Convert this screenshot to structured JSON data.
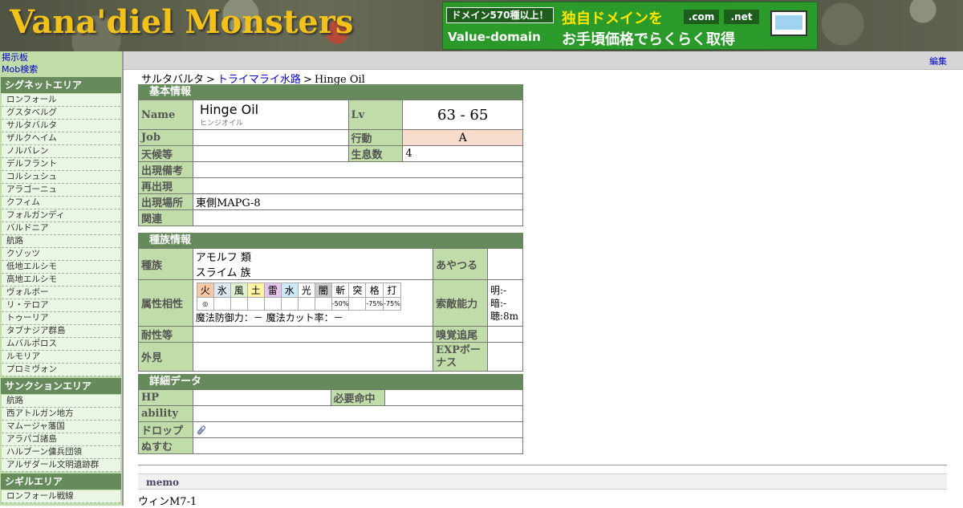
{
  "site": {
    "title": "Vana'diel Monsters"
  },
  "banner": {
    "tag": "ドメイン570種以上！",
    "logo": "Value-domain",
    "line1": "独自ドメインを",
    "line2": "お手頃価格でらくらく取得",
    "tld1": ".com",
    "tld2": ".net"
  },
  "sidebar": {
    "links": [
      "掲示板",
      "Mob検索"
    ],
    "areas": [
      {
        "title": "シグネットエリア",
        "items": [
          "ロンフォール",
          "グスタベルグ",
          "サルタバルタ",
          "ザルクヘイム",
          "ノルバレン",
          "デルフラント",
          "コルシュシュ",
          "アラゴーニュ",
          "クフィム",
          "フォルガンディ",
          "バルドニア",
          "航路",
          "クゾッツ",
          "低地エルシモ",
          "高地エルシモ",
          "ヴォルボー",
          "リ・テロア",
          "トゥーリア",
          "タブナジア群島",
          "ムバルポロス",
          "ルモリア",
          "プロミヴォン"
        ]
      },
      {
        "title": "サンクションエリア",
        "items": [
          "航路",
          "西アトルガン地方",
          "マムージャ藩国",
          "アラパゴ諸島",
          "ハルブーン傭兵団領",
          "アルザダール文明遺跡群"
        ]
      },
      {
        "title": "シギルエリア",
        "items": [
          "ロンフォール戦線"
        ]
      }
    ]
  },
  "topbar": {
    "edit": "編集"
  },
  "breadcrumb": {
    "area": "サルタバルタ",
    "zone": "トライマライ水路",
    "mob": "Hinge Oil",
    "sep": ">"
  },
  "basic": {
    "header": "基本情報",
    "name_label": "Name",
    "name": "Hinge Oil",
    "kana": "ヒンジオイル",
    "lv_label": "Lv",
    "lv": "63 - 65",
    "job_label": "Job",
    "job": "",
    "action_label": "行動",
    "action": "A",
    "weather_label": "天候等",
    "weather": "",
    "count_label": "生息数",
    "count": "4",
    "spawn_note_label": "出現備考",
    "spawn_note": "",
    "respawn_label": "再出現",
    "respawn": "",
    "location_label": "出現場所",
    "location": "東側MAPG-8",
    "related_label": "関連",
    "related": ""
  },
  "race": {
    "header": "種族情報",
    "family_label": "種族",
    "family1": "アモルフ 類",
    "family2": "スライム 族",
    "charm_label": "あやつる",
    "charm": "",
    "affinity_label": "属性相性",
    "elements": [
      "火",
      "氷",
      "風",
      "土",
      "雷",
      "水",
      "光",
      "闇",
      "斬",
      "突",
      "格",
      "打"
    ],
    "element_colors": [
      "#f6c8a8",
      "#dde9f4",
      "#dff2d0",
      "#fff3a0",
      "#e6c6ee",
      "#cce9f6",
      "#ffffff",
      "#cccccc",
      "#ffffff",
      "#ffffff",
      "#ffffff",
      "#ffffff"
    ],
    "element_values": [
      "◎",
      "",
      "",
      "",
      "",
      "",
      "",
      "",
      "-50%",
      "",
      "-75%",
      "-75%"
    ],
    "magic_line": "魔法防御力：－ 魔法カット率：－",
    "detect_label": "索敵能力",
    "detect_light": "明:-",
    "detect_dark": "暗:-",
    "detect_sound": "聴:8m",
    "resist_label": "耐性等",
    "resist": "",
    "scent_label": "嗅覚追尾",
    "scent": "",
    "look_label": "外見",
    "look": "",
    "exp_label": "EXPボーナス",
    "exp": ""
  },
  "detail": {
    "header": "詳細データ",
    "hp_label": "HP",
    "hp": "",
    "acc_label": "必要命中",
    "acc": "",
    "ability_label": "ability",
    "ability": "",
    "drop_label": "ドロップ",
    "drop_icon": "potion-icon",
    "steal_label": "ぬすむ",
    "steal": ""
  },
  "memo": {
    "header": "memo",
    "text": "ウィンM7-1"
  }
}
